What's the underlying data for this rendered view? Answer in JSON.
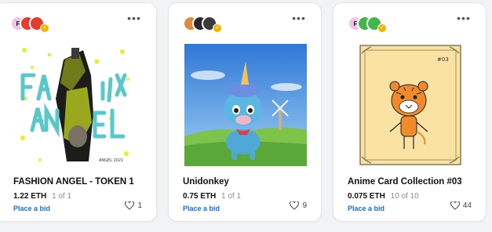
{
  "cards": [
    {
      "title": "FASHION ANGEL - TOKEN 1",
      "price": "1.22 ETH",
      "edition": "1 of 1",
      "action": "Place a bid",
      "likes": "1",
      "art_text": [
        "FA",
        "SHION",
        "AN",
        "GEL"
      ],
      "avatars": [
        {
          "label": "F",
          "color": "#f3c2e6"
        },
        {
          "label": "",
          "color": "#e63b2e"
        },
        {
          "label": "",
          "color": "#e63b2e"
        }
      ]
    },
    {
      "title": "Unidonkey",
      "price": "0.75 ETH",
      "edition": "1 of 1",
      "action": "Place a bid",
      "likes": "9",
      "avatars": [
        {
          "label": "",
          "color": "#e08a3c"
        },
        {
          "label": "",
          "color": "#2a2a2a"
        },
        {
          "label": "",
          "color": "#3a3a3a"
        }
      ]
    },
    {
      "title": "Anime Card Collection #03",
      "price": "0.075 ETH",
      "edition": "10 of 10",
      "action": "Place a bid",
      "likes": "44",
      "card_label": "#03",
      "avatars": [
        {
          "label": "F",
          "color": "#f3c2e6"
        },
        {
          "label": "",
          "color": "#43b649"
        },
        {
          "label": "",
          "color": "#43b649"
        }
      ]
    }
  ],
  "colors": {
    "link": "#1a6ed8",
    "verified_badge": "#f4b400"
  }
}
